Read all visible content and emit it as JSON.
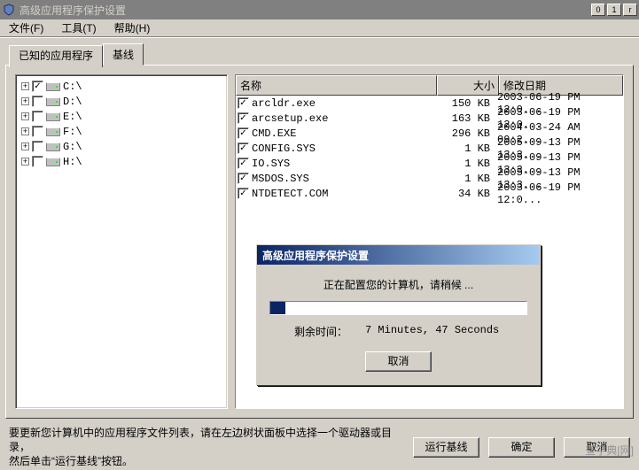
{
  "window": {
    "title": "高级应用程序保护设置",
    "icon": "shield-icon"
  },
  "menu": {
    "file": "文件(F)",
    "tools": "工具(T)",
    "help": "帮助(H)"
  },
  "tabs": {
    "known_apps": "已知的应用程序",
    "baseline": "基线"
  },
  "tree": {
    "drives": [
      {
        "label": "C:\\",
        "checked": true
      },
      {
        "label": "D:\\",
        "checked": false
      },
      {
        "label": "E:\\",
        "checked": false
      },
      {
        "label": "F:\\",
        "checked": false
      },
      {
        "label": "G:\\",
        "checked": false
      },
      {
        "label": "H:\\",
        "checked": false
      }
    ]
  },
  "list": {
    "headers": {
      "name": "名称",
      "size": "大小",
      "date": "修改日期"
    },
    "rows": [
      {
        "name": "arcldr.exe",
        "size": "150 KB",
        "date": "2003-06-19 PM 12:0..."
      },
      {
        "name": "arcsetup.exe",
        "size": "163 KB",
        "date": "2003-06-19 PM 12:0..."
      },
      {
        "name": "CMD.EXE",
        "size": "296 KB",
        "date": "2004-03-24 AM 09:2..."
      },
      {
        "name": "CONFIG.SYS",
        "size": "1 KB",
        "date": "2005-09-13 PM 13:3..."
      },
      {
        "name": "IO.SYS",
        "size": "1 KB",
        "date": "2005-09-13 PM 13:3..."
      },
      {
        "name": "MSDOS.SYS",
        "size": "1 KB",
        "date": "2005-09-13 PM 13:3..."
      },
      {
        "name": "NTDETECT.COM",
        "size": "34 KB",
        "date": "2003-06-19 PM 12:0..."
      }
    ]
  },
  "hint": {
    "line1": "要更新您计算机中的应用程序文件列表，请在左边树状面板中选择一个驱动器或目录，",
    "line2": "然后单击“运行基线”按钮。"
  },
  "buttons": {
    "run_baseline": "运行基线",
    "ok": "确定",
    "cancel": "取消"
  },
  "dialog": {
    "title": "高级应用程序保护设置",
    "message": "正在配置您的计算机，请稍候 ...",
    "time_label": "剩余时间：",
    "time_value": "7 Minutes, 47 Seconds",
    "cancel": "取消",
    "progress_pct": 6
  },
  "watermark": "查字典[网]"
}
